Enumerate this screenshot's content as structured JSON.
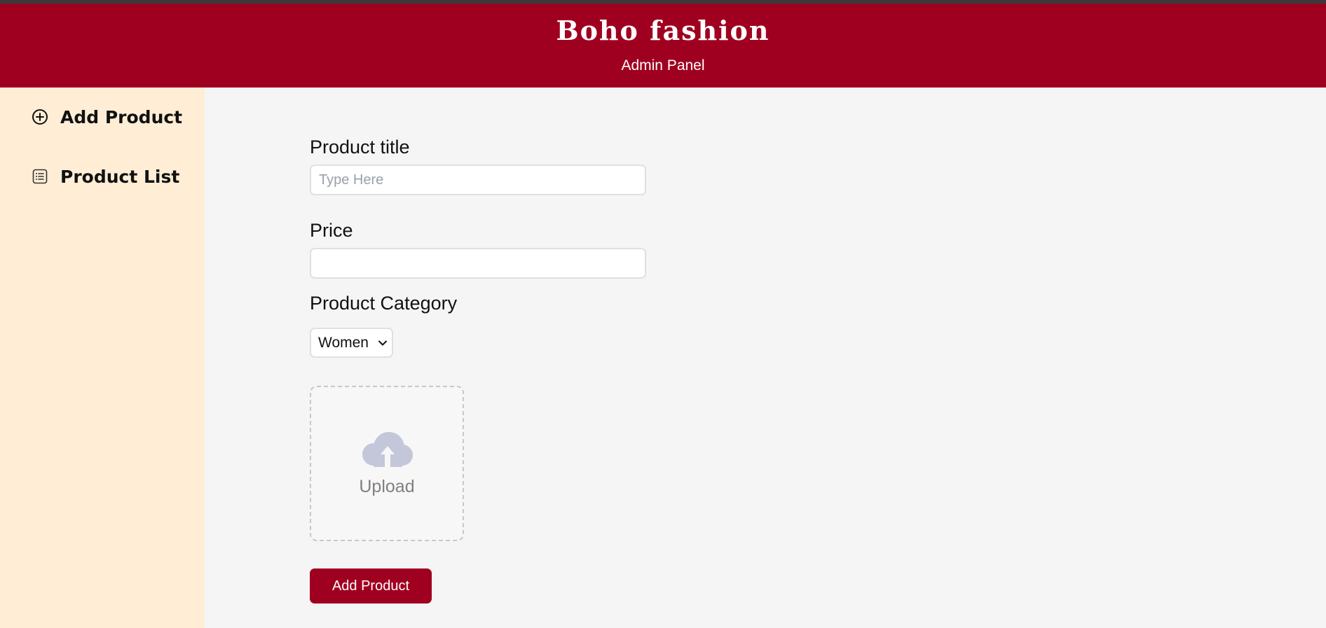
{
  "header": {
    "brand": "Boho fashion",
    "subtitle": "Admin Panel",
    "background_color": "#a00020"
  },
  "sidebar": {
    "background_color": "#ffeed5",
    "items": [
      {
        "label": "Add Product",
        "icon": "plus-circle-icon"
      },
      {
        "label": "Product List",
        "icon": "list-icon"
      }
    ]
  },
  "form": {
    "title_label": "Product title",
    "title_placeholder": "Type Here",
    "title_value": "",
    "price_label": "Price",
    "price_value": "",
    "category_label": "Product Category",
    "category_selected": "Women",
    "upload_label": "Upload",
    "upload_icon": "cloud-upload-icon",
    "submit_label": "Add Product",
    "accent_color": "#a00020"
  }
}
